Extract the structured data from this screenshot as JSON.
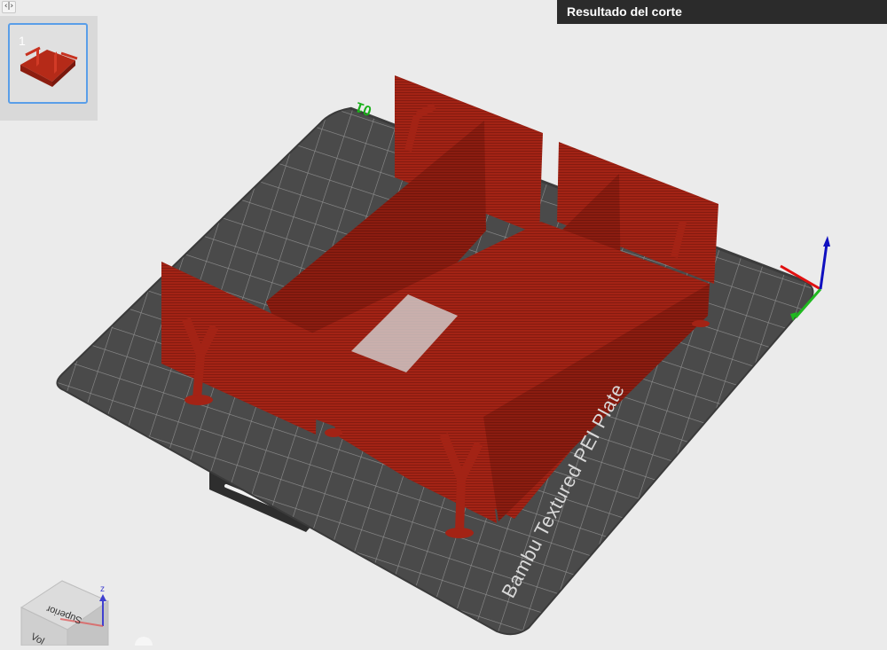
{
  "window": {
    "collapse_glyph": "‹|›",
    "slice_panel_title": "Resultado del corte"
  },
  "plate_list": {
    "plates": [
      {
        "number": "1",
        "selected": true
      }
    ]
  },
  "bed": {
    "label": "Bambu Textured PEI Plate",
    "corner_number": "01"
  },
  "view_cube": {
    "top_face": "Superior",
    "front_face": "Vol",
    "axis_label": "z"
  },
  "colors": {
    "accent": "#5a9ee8",
    "model": "#a32315",
    "bed": "#4a4a4a",
    "grid": "#8f8f8f",
    "axis_x": "#e01010",
    "axis_y": "#1fb81f",
    "axis_z": "#1010c0",
    "number_green": "#19b019"
  }
}
